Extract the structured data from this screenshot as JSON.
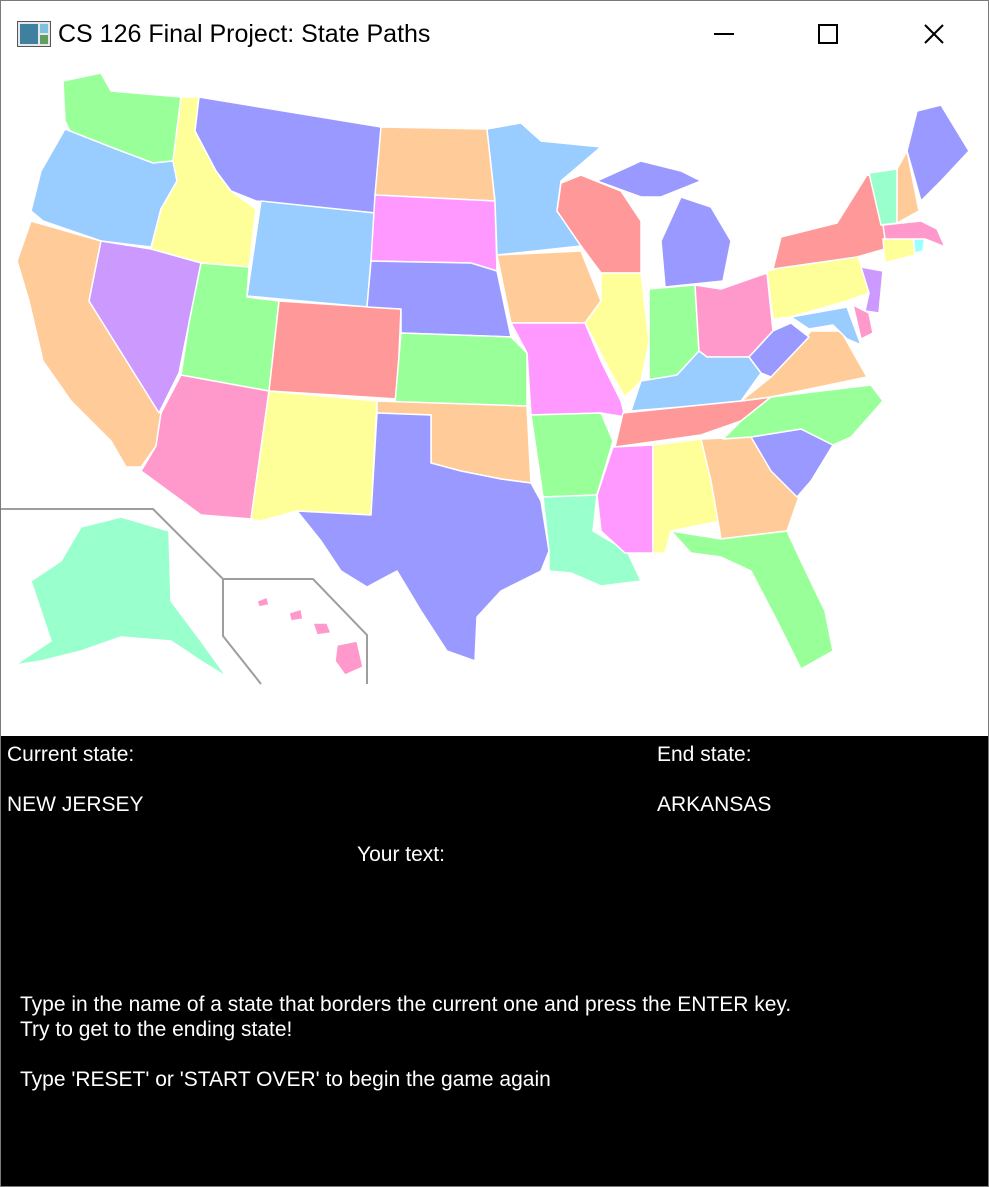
{
  "window": {
    "title": "CS 126 Final Project: State Paths",
    "app_icon": "app-window-icon",
    "controls": [
      "minimize-icon",
      "maximize-icon",
      "close-icon"
    ]
  },
  "map": {
    "background": "#ffffff",
    "palette": {
      "green": "#99ff99",
      "light_blue": "#99ccff",
      "yellow": "#ffff99",
      "periwinkle": "#9999ff",
      "peach": "#ffcc99",
      "pink": "#ff99ff",
      "salmon": "#ff9999",
      "lavender": "#cc99ff",
      "rose": "#ff99cc",
      "mint": "#99ffcc",
      "cyan": "#99ffff"
    }
  },
  "panel": {
    "current_state_label": "Current state:",
    "current_state_value": "NEW JERSEY",
    "end_state_label": "End state:",
    "end_state_value": "ARKANSAS",
    "your_text_label": "Your text:",
    "your_text_value": "",
    "instruction_1": "Type in the name of a state that borders the current one and press the ENTER key.",
    "instruction_2": "Try to get to the ending state!",
    "instruction_3": "Type 'RESET' or 'START OVER' to begin the game again"
  }
}
